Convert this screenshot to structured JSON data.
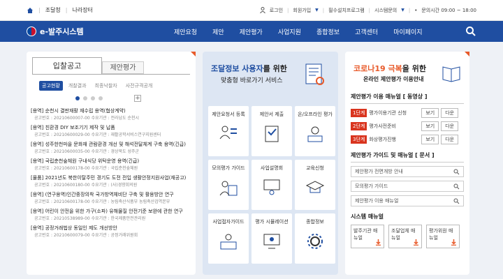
{
  "topbar": {
    "left_links": [
      "조달청",
      "나라장터"
    ],
    "right_links": [
      "로그인",
      "회원가입",
      "필수설치프로그램",
      "시스템문의"
    ],
    "hours": "문의시간 09:00 ~ 18:00"
  },
  "nav": {
    "logo_text": "e-발주시스템",
    "menu": [
      "제안요청",
      "제안",
      "제안평가",
      "사업지원",
      "종합정보",
      "고객센터",
      "마이페이지"
    ]
  },
  "notice_panel": {
    "tab_active": "입찰공고",
    "tab_inactive": "제안평가",
    "subtabs": [
      "공고현황",
      "개찰결과",
      "최종낙찰자",
      "사전규격공개"
    ],
    "items": [
      {
        "title": "[용역] 순천시 결판재활 재수립 용역(협상계약)",
        "meta": "공고번호 : 20210600007-00   수요기관 : 전라남도 순천시"
      },
      {
        "title": "[용역] 친환경 DIY 보조기기 제작 및 납품",
        "meta": "공고번호 : 20210600029-00   수요기관 : 재활공학서비스연구지원센터"
      },
      {
        "title": "[용역] 성주한천마을 문화재 관람환경 개선 및 해석전달체계 구축 용역(긴급)",
        "meta": "공고번호 : 20210600035-00   수요기관 : 경상북도 성주군"
      },
      {
        "title": "[용역] 국립춘천숲체원 구내식당 위탁운영 용역(긴급)",
        "meta": "공고번호 : 20210600178-00   수요기관 : 국립춘천숲체원"
      },
      {
        "title": "[물품] 2021년도 북한이탈주민 경기도 도전 전입 생활안정지원사업(재공고)",
        "meta": "공고번호 : 20210600180-00   수요기관 : (사)경향회의원"
      },
      {
        "title": "[용역] (연구용역)인간중장의착 국가방역체비단 구축 및 활용방안 연구",
        "meta": "공고번호 : 20210600178-00   수요기관 : 농림축산식품부 농림축산검역본부"
      },
      {
        "title": "[용역] 어린이 안전을 위한 가구(소파) 유해물질 안전기준 보완에 관한 연구",
        "meta": "공고번호 : 20210538989-00   수요기관 : 한국제품안전관리원"
      },
      {
        "title": "[용역] 공정거래법상 동일인 제도 개선방안",
        "meta": "공고번호 : 20210600079-00   수요기관 : 공정거래위원회"
      }
    ]
  },
  "service_panel": {
    "title_highlight": "조달정보 사용자",
    "title_rest": "를 위한",
    "subtitle": "맞춤형 바로가기 서비스",
    "cards": [
      "제안요청서 등록",
      "제안서 제출",
      "온/오프라인 평가",
      "모의평가 가이드",
      "사업설명회",
      "교육신청",
      "사업접자가이드",
      "평가 시뮬레이션",
      "종합정보"
    ]
  },
  "covid_panel": {
    "title_highlight": "코로나19 극복",
    "title_rest": "을 위한",
    "subtitle": "온라인 제안평가 이용안내",
    "video_section": "제안평가 이용 매뉴얼 [ 동영상 ]",
    "steps": [
      {
        "badge": "1단계",
        "label": "평가이용기관 신청",
        "btn1": "보기",
        "btn2": "다운"
      },
      {
        "badge": "2단계",
        "label": "평가사전준비",
        "btn1": "보기",
        "btn2": "다운"
      },
      {
        "badge": "3단계",
        "label": "화상평가진행",
        "btn1": "보기",
        "btn2": "다운"
      }
    ],
    "guide_section": "제안평가 가이드 및 매뉴얼 [ 문서 ]",
    "guides": [
      "제안평가 전면개방 안내",
      "모의평가 가이드",
      "제안평가 이용 매뉴얼"
    ],
    "system_section": "시스템 매뉴얼",
    "manuals": [
      "발주기관 매뉴얼",
      "조달업체 매뉴얼",
      "평가위원 매뉴얼"
    ]
  },
  "colors": {
    "nav": "#1f4ea1",
    "accent": "#e85a2a",
    "step_badge": "#d9341e"
  }
}
